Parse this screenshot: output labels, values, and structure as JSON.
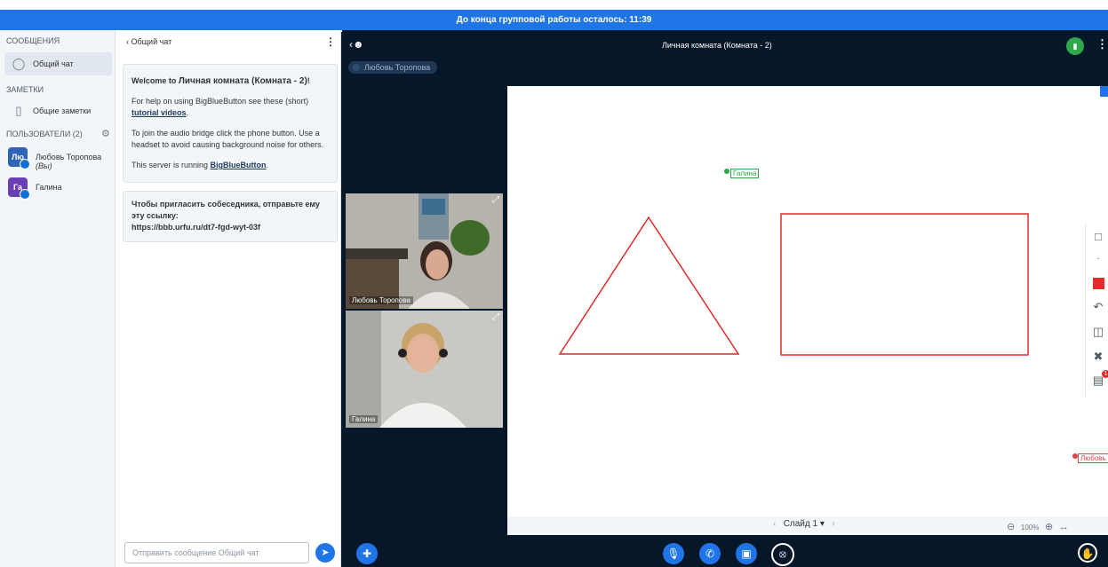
{
  "banner": {
    "text": "До конца групповой работы осталось: 11:39"
  },
  "left": {
    "messages_title": "СООБЩЕНИЯ",
    "public_chat": "Общий чат",
    "notes_title": "ЗАМЕТКИ",
    "shared_notes": "Общие заметки",
    "users_title": "ПОЛЬЗОВАТЕЛИ (2)",
    "users": [
      {
        "initials": "Лю",
        "name": "Любовь Торопова",
        "suffix": "(Вы)",
        "color": "#2e63b8"
      },
      {
        "initials": "Га",
        "name": "Галина",
        "suffix": "",
        "color": "#6a3fb5"
      }
    ]
  },
  "chat": {
    "header": "Общий чат",
    "welcome_prefix": "Welcome to ",
    "welcome_room": "Личная комната (Комната - 2)",
    "welcome_suffix": "!",
    "help_prefix": "For help on using BigBlueButton see these (short) ",
    "help_link": "tutorial videos",
    "help_suffix": ".",
    "audio_text": "To join the audio bridge click the phone button. Use a headset to avoid causing background noise for others.",
    "server_prefix": "This server is running ",
    "server_link": "BigBlueButton",
    "server_suffix": ".",
    "invite_text": "Чтобы пригласить собеседника, отправьте ему эту ссылку:",
    "invite_url": "https://bbb.urfu.ru/dt7-fgd-wyt-03f",
    "input_placeholder": "Отправить сообщение Общий чат"
  },
  "room": {
    "title": "Личная комната (Комната - 2)",
    "talker": "Любовь Торопова"
  },
  "whiteboard": {
    "cursor_galina": "Галина",
    "cursor_lyubov": "Любовь",
    "slide_label": "Слайд 1",
    "zoom": "100%",
    "badge_count": "1"
  },
  "videos": [
    {
      "label": "Любовь Торопова"
    },
    {
      "label": "Галина"
    }
  ],
  "colors": {
    "accent": "#1f74e8",
    "shape_stroke": "#e32b2b",
    "galina_cursor": "#2ea84a",
    "lyubov_cursor": "#e0424a"
  }
}
